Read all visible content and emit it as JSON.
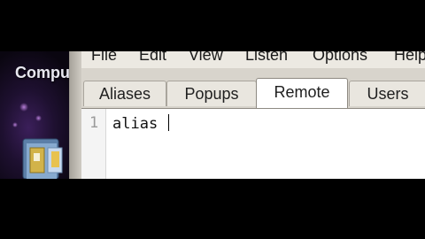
{
  "desktop": {
    "label": "Compu",
    "icon": "folder-icon"
  },
  "menubar": {
    "items": [
      "File",
      "Edit",
      "View",
      "Listen",
      "Options",
      "Help"
    ]
  },
  "tabs": [
    {
      "label": "Aliases",
      "active": false
    },
    {
      "label": "Popups",
      "active": false
    },
    {
      "label": "Remote",
      "active": true
    },
    {
      "label": "Users",
      "active": false
    }
  ],
  "editor": {
    "line_number": "1",
    "text": "alias "
  },
  "colors": {
    "window_bg": "#d8d4cc",
    "active_tab": "#ffffff",
    "editor_bg": "#ffffff",
    "desktop_accent": "#3b1f5a"
  }
}
